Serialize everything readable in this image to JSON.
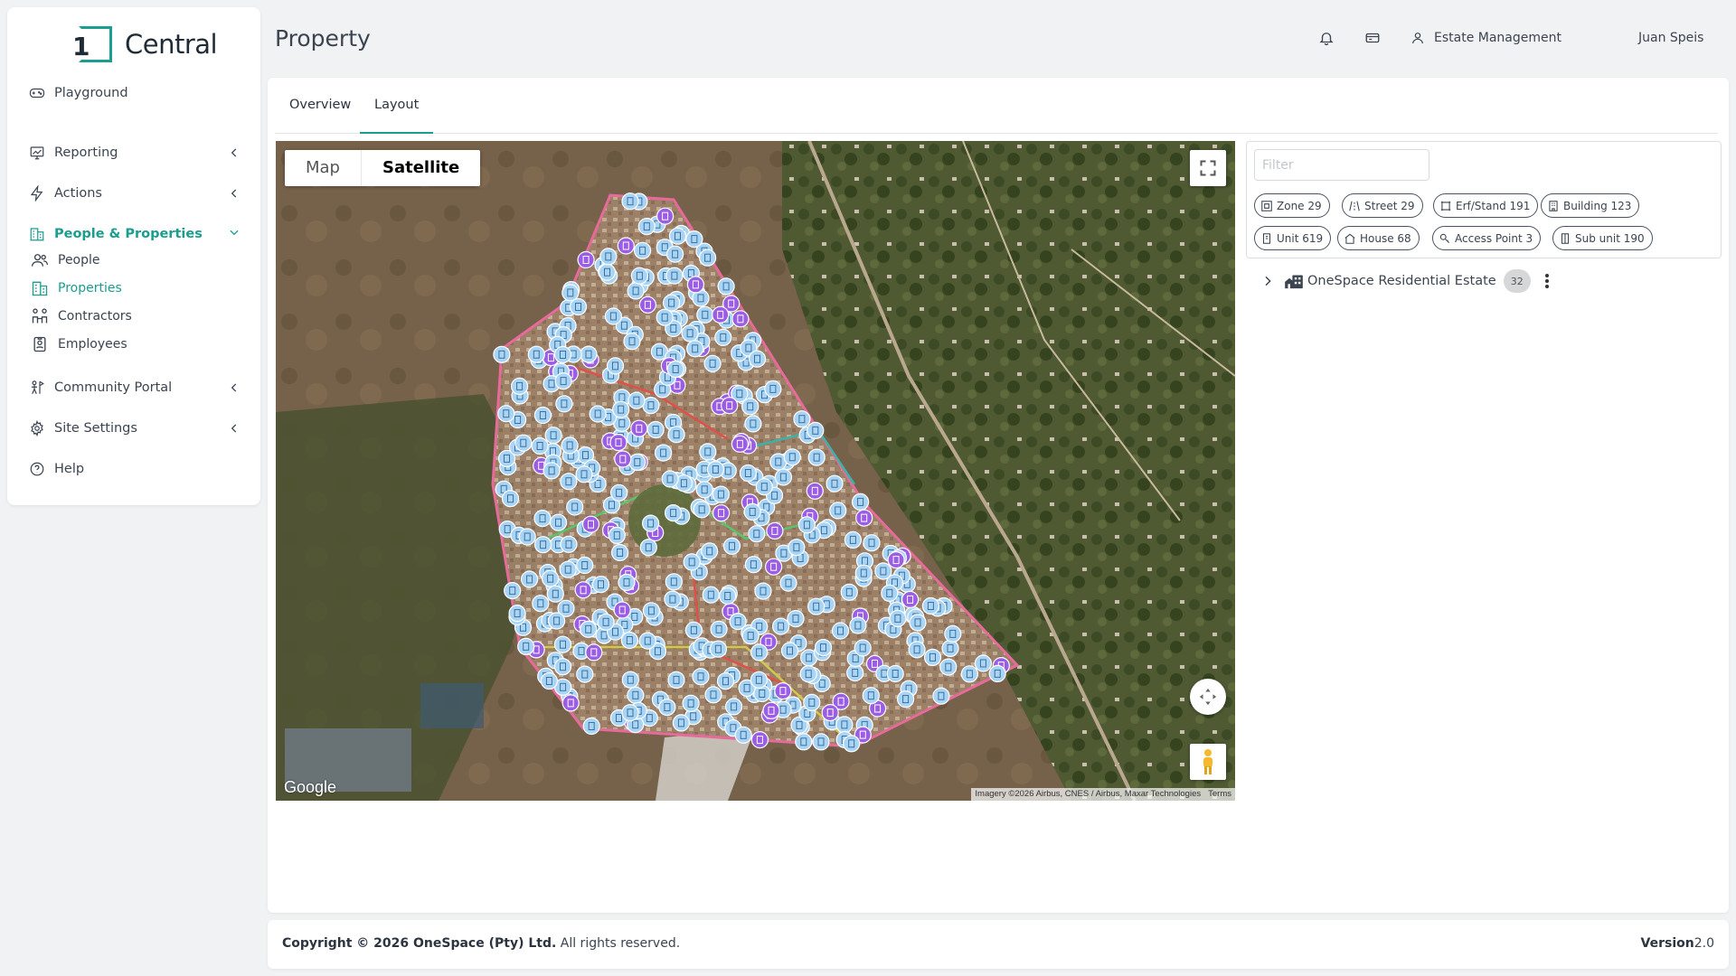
{
  "app": {
    "logo_digit": "1",
    "logo_text": "Central"
  },
  "sidebar": {
    "playground": "Playground",
    "reporting": "Reporting",
    "actions": "Actions",
    "people_properties": "People & Properties",
    "people": "People",
    "properties": "Properties",
    "contractors": "Contractors",
    "employees": "Employees",
    "community_portal": "Community Portal",
    "site_settings": "Site Settings",
    "help": "Help"
  },
  "header": {
    "title": "Property",
    "estate": "Estate Management",
    "user": "Juan Speis"
  },
  "tabs": {
    "overview": "Overview",
    "layout": "Layout"
  },
  "map": {
    "type_map": "Map",
    "type_satellite": "Satellite",
    "selected_type": "Satellite",
    "google": "Google",
    "imagery": "Imagery ©2026 Airbus, CNES / Airbus, Maxar Technologies",
    "terms": "Terms"
  },
  "filter": {
    "placeholder": "Filter",
    "chips": [
      {
        "label": "Zone 29",
        "icon": "zone-icon"
      },
      {
        "label": "Street 29",
        "icon": "street-icon"
      },
      {
        "label": "Erf/Stand 191",
        "icon": "erf-stand-icon"
      },
      {
        "label": "Building 123",
        "icon": "building-icon"
      },
      {
        "label": "Unit 619",
        "icon": "unit-icon"
      },
      {
        "label": "House 68",
        "icon": "house-icon"
      },
      {
        "label": "Access Point 3",
        "icon": "access-point-icon"
      },
      {
        "label": "Sub unit 190",
        "icon": "sub-unit-icon"
      }
    ]
  },
  "tree": {
    "label": "OneSpace Residential Estate",
    "count": "32"
  },
  "footer": {
    "copyright_prefix": "Copyright © 2026 OneSpace (Pty) Ltd.",
    "copyright_suffix": "All rights reserved.",
    "version_label": "Version",
    "version_number": "2.0"
  },
  "colors": {
    "accent": "#1a9e8f",
    "text": "#3b4450",
    "marker_unit": "#a8d4f5",
    "marker_house": "#9b5de5"
  }
}
